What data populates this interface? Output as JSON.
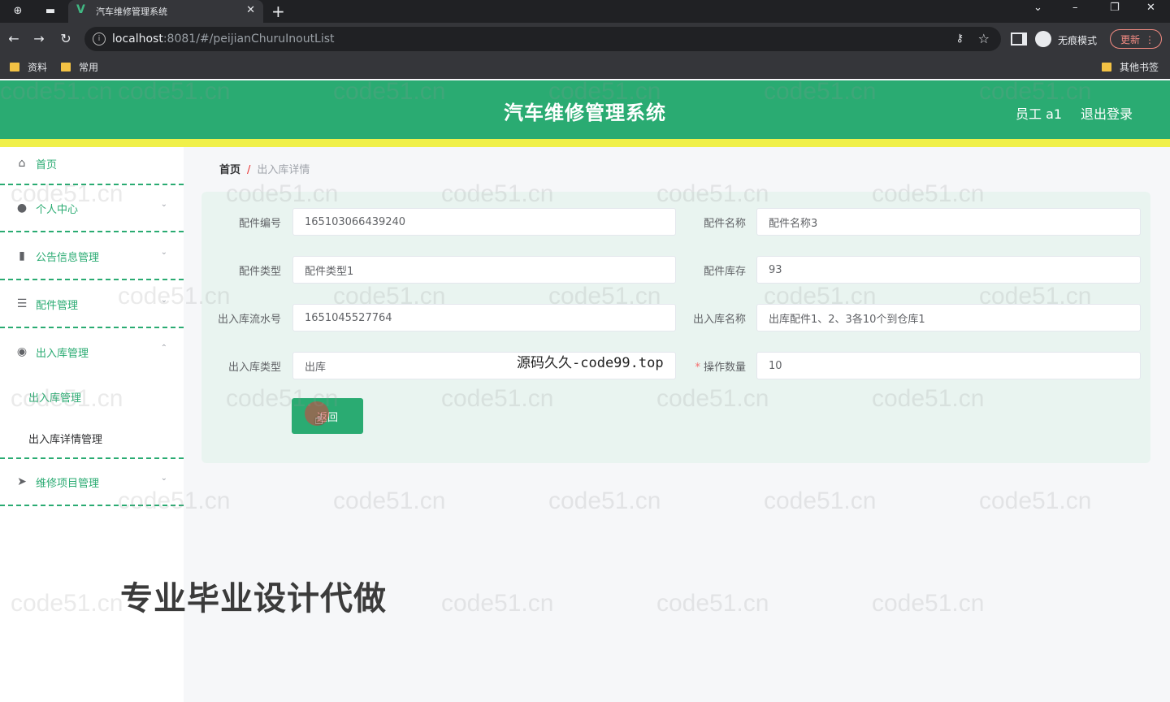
{
  "browser": {
    "tab_title": "汽车维修管理系统",
    "url_host": "localhost",
    "url_rest": ":8081/#/peijianChuruInoutList",
    "incognito_label": "无痕模式",
    "update_label": "更新",
    "bookmarks": [
      "资料",
      "常用"
    ],
    "other_bookmarks": "其他书签"
  },
  "header": {
    "title": "汽车维修管理系统",
    "user": "员工 a1",
    "logout": "退出登录"
  },
  "sidebar": {
    "items": [
      {
        "label": "首页"
      },
      {
        "label": "个人中心"
      },
      {
        "label": "公告信息管理"
      },
      {
        "label": "配件管理"
      },
      {
        "label": "出入库管理"
      },
      {
        "label": "维修项目管理"
      }
    ],
    "sub_items": [
      "出入库管理",
      "出入库详情管理"
    ]
  },
  "breadcrumb": {
    "home": "首页",
    "separator": "/",
    "current": "出入库详情"
  },
  "form": {
    "part_no_label": "配件编号",
    "part_no": "165103066439240",
    "part_name_label": "配件名称",
    "part_name": "配件名称3",
    "part_type_label": "配件类型",
    "part_type": "配件类型1",
    "part_stock_label": "配件库存",
    "part_stock": "93",
    "serial_label": "出入库流水号",
    "serial": "1651045527764",
    "inout_name_label": "出入库名称",
    "inout_name": "出库配件1、2、3各10个到仓库1",
    "inout_type_label": "出入库类型",
    "inout_type": "出库",
    "qty_required": "*",
    "qty_label": "操作数量",
    "qty": "10",
    "back_label": "返回"
  },
  "overlays": {
    "site_text": "源码久久-code99.top",
    "promo": "专业毕业设计代做",
    "watermark": "code51.cn"
  },
  "colors": {
    "brand": "#2aab72",
    "accent_bar": "#f0f04a",
    "panel": "#e9f4f0"
  }
}
